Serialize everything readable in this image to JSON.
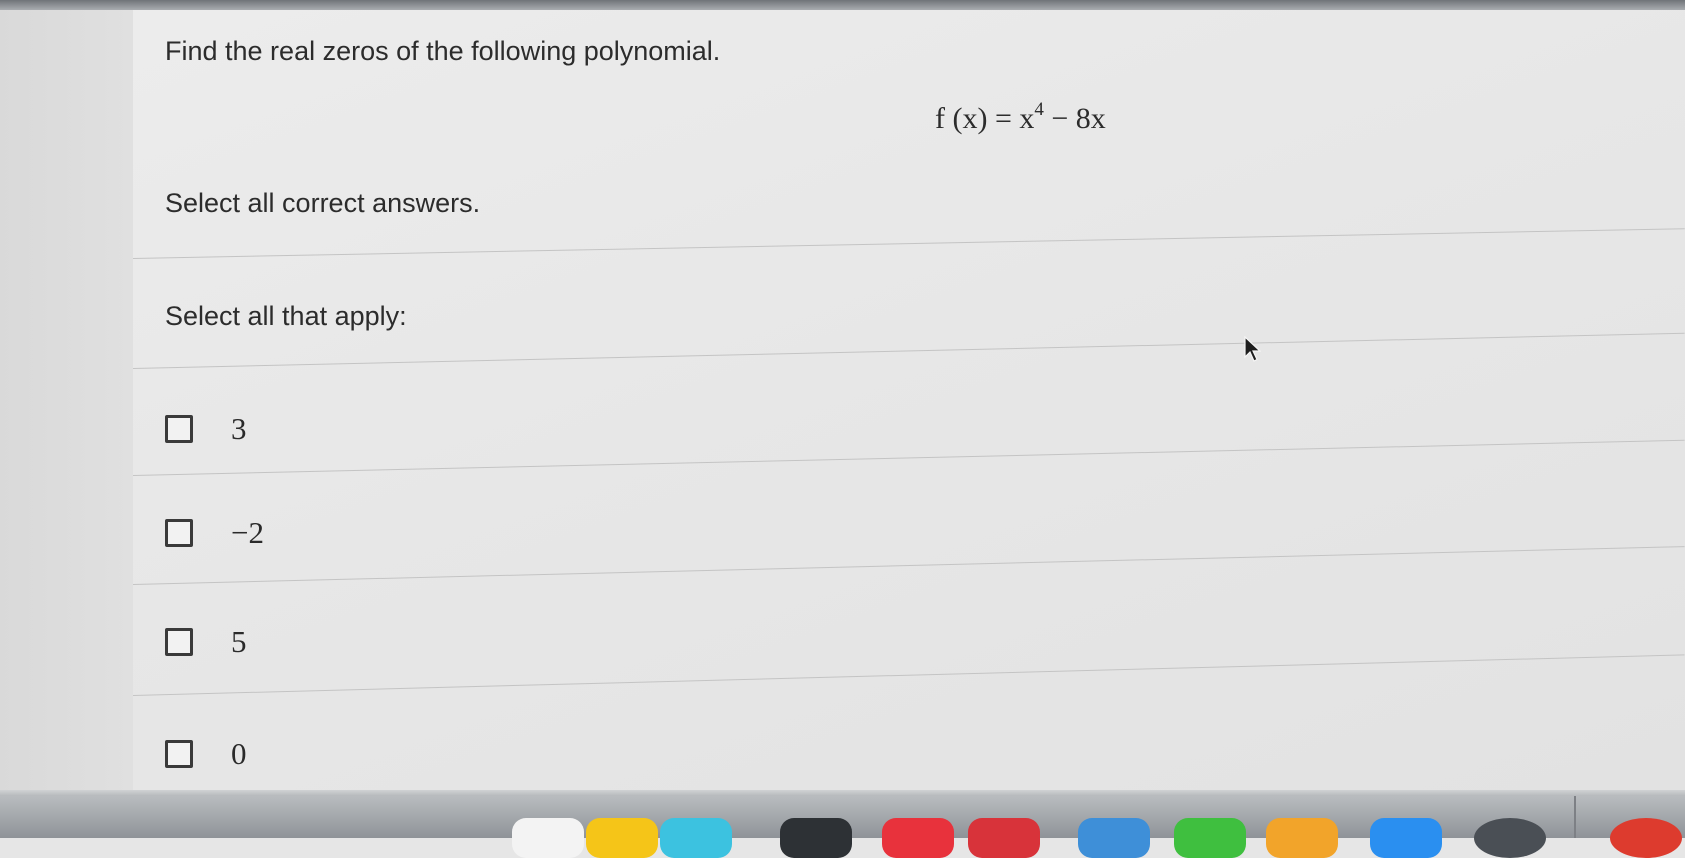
{
  "question": {
    "prompt": "Find the real zeros of the following polynomial.",
    "formula_lhs": "f (x) = x",
    "formula_exponent": "4",
    "formula_rhs": " − 8x",
    "instruction": "Select all correct answers.",
    "select_label": "Select all that apply:"
  },
  "options": [
    {
      "label": "3",
      "checked": false
    },
    {
      "label": "−2",
      "checked": false
    },
    {
      "label": "5",
      "checked": false
    },
    {
      "label": "0",
      "checked": false
    }
  ],
  "dock": {
    "icons": [
      "app-icon-white",
      "notes-icon",
      "app-icon-cyan",
      "app-icon-dark",
      "app-icon-red",
      "app-icon-red-2",
      "finder-icon",
      "numbers-icon",
      "pages-icon",
      "app-store-icon",
      "safari-icon",
      "chrome-icon"
    ],
    "colors": [
      "#f3f3f3",
      "#f5c518",
      "#3cc2e0",
      "#2d3135",
      "#e8323c",
      "#d8333a",
      "#3e8fd8",
      "#3fbf3f",
      "#f2a42a",
      "#2a8ff0",
      "#4a4f55",
      "#dd3b2e"
    ]
  }
}
